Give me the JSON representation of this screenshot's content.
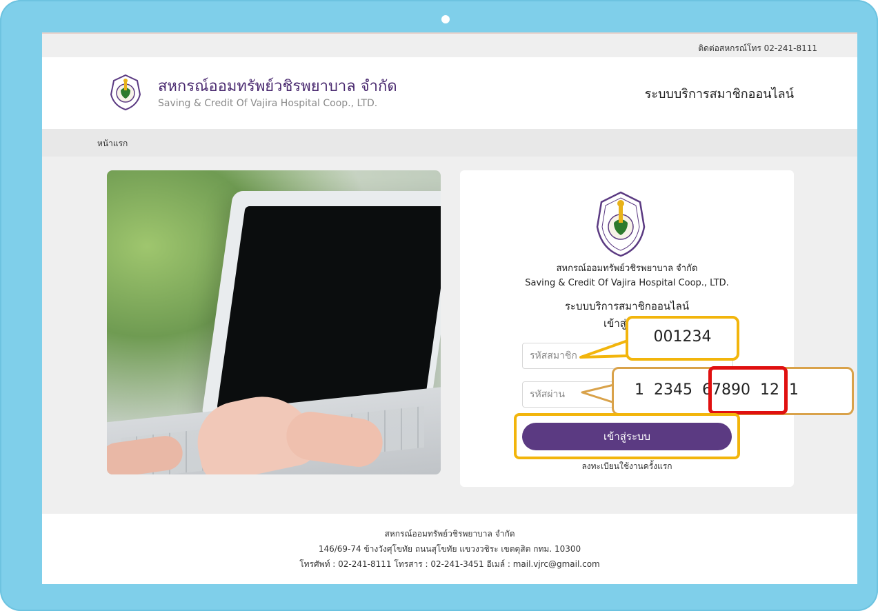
{
  "topbar": {
    "contact": "ติดต่อสหกรณ์โทร 02-241-8111"
  },
  "header": {
    "brand_th": "สหกรณ์ออมทรัพย์วชิรพยาบาล จำกัด",
    "brand_en": "Saving & Credit Of Vajira Hospital Coop., LTD.",
    "system_title": "ระบบบริการสมาชิกออนไลน์"
  },
  "breadcrumb": {
    "home": "หน้าแรก"
  },
  "login_card": {
    "org_th": "สหกรณ์ออมทรัพย์วชิรพยาบาล จำกัด",
    "org_en": "Saving & Credit Of Vajira Hospital Coop., LTD.",
    "system": "ระบบบริการสมาชิกออนไลน์",
    "login_heading": "เข้าสู่ระบบ",
    "member_placeholder": "รหัสสมาชิก",
    "member_value": "",
    "password_placeholder": "รหัสผ่าน",
    "password_value": "",
    "login_button": "เข้าสู่ระบบ",
    "register_link": "ลงทะเบียนใช้งานครั้งแรก"
  },
  "callouts": {
    "member_example": "001234",
    "password_example_parts": [
      "1",
      "2345",
      "67890",
      "12",
      "1"
    ]
  },
  "footer": {
    "line1": "สหกรณ์ออมทรัพย์วชิรพยาบาล จำกัด",
    "line2": "146/69-74 ข้างวังศุโขทัย ถนนสุโขทัย แขวงวชิระ เขตดุสิต กทม. 10300",
    "line3": "โทรศัพท์ : 02-241-8111 โทรสาร : 02-241-3451 อีเมล์ : mail.vjrc@gmail.com"
  },
  "colors": {
    "tablet_frame": "#7fcfea",
    "brand_purple": "#5b3a82",
    "callout_border": "#f2b50c",
    "highlight_red": "#e01010"
  }
}
